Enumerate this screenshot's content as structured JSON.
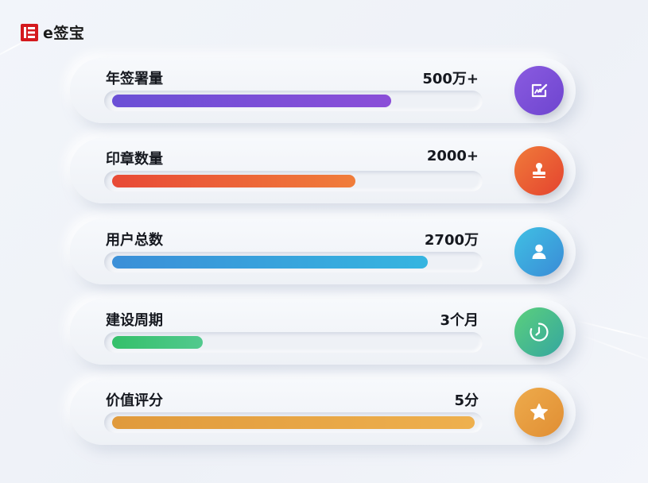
{
  "brand": {
    "name": "e签宝",
    "logo_color": "#d4191d"
  },
  "stats": [
    {
      "label": "年签署量",
      "value": "500万+",
      "progress": 0.77,
      "icon": "signature-pen-icon",
      "colors": {
        "start": "#6a4fd6",
        "end": "#8a4ed8"
      }
    },
    {
      "label": "印章数量",
      "value": "2000+",
      "progress": 0.67,
      "icon": "seal-stamp-icon",
      "colors": {
        "start": "#e84a36",
        "end": "#f07d3a"
      }
    },
    {
      "label": "用户总数",
      "value": "2700万",
      "progress": 0.87,
      "icon": "user-icon",
      "colors": {
        "start": "#3b8fd8",
        "end": "#35b5e0"
      }
    },
    {
      "label": "建设周期",
      "value": "3个月",
      "progress": 0.25,
      "icon": "clock-icon",
      "colors": {
        "start": "#34c06a",
        "end": "#52c98e"
      }
    },
    {
      "label": "价值评分",
      "value": "5分",
      "progress": 1.0,
      "icon": "star-icon",
      "colors": {
        "start": "#e09a3c",
        "end": "#eeb04e"
      }
    }
  ]
}
